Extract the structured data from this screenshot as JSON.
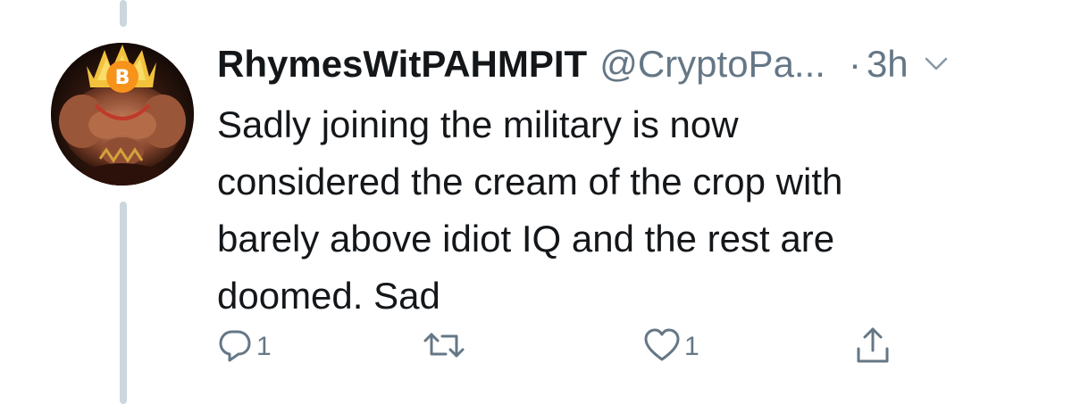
{
  "tweet": {
    "display_name": "RhymesWitPAHMPIT",
    "handle": "@CryptoPa...",
    "dot": "·",
    "time": "3h",
    "text": "Sadly joining the military is now\nconsidered the cream of the crop with\nbarely above idiot IQ and the rest are\ndoomed. Sad"
  },
  "actions": {
    "reply_count": "1",
    "like_count": "1"
  },
  "icons": {
    "reply": "reply-icon",
    "retweet": "retweet-icon",
    "like": "heart-icon",
    "share": "share-icon",
    "menu": "chevron-down-icon",
    "avatar_badge": "bitcoin-icon"
  },
  "colors": {
    "text": "#14171a",
    "secondary": "#657786",
    "thread_line": "#ccd6dd",
    "bitcoin": "#f7931a"
  }
}
